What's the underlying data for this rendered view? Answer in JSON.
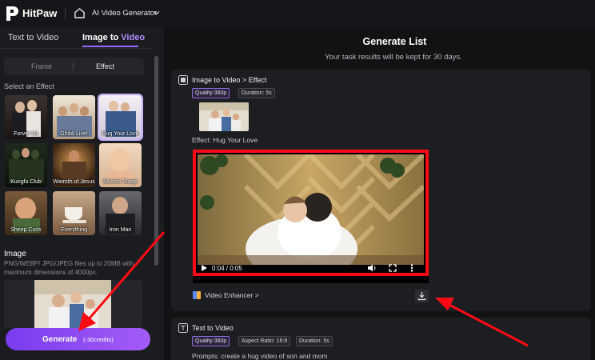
{
  "topbar": {
    "brand": "HitPaw",
    "app_title": "AI Video Generator"
  },
  "sidebar": {
    "tabs": [
      {
        "label": "Text to Video",
        "active": false
      },
      {
        "label_prefix": "Image to ",
        "label_accent": "Video",
        "active": true
      }
    ],
    "segment": {
      "frame": "Frame",
      "effect": "Effect",
      "selected": "Effect"
    },
    "select_label": "Select an Effect",
    "effects": [
      {
        "label": "Forver Us"
      },
      {
        "label": "Ghibli Live!"
      },
      {
        "label": "Hug Your Love",
        "selected": true
      },
      {
        "label": "Kungfu Club"
      },
      {
        "label": "Warmth of Jesus"
      },
      {
        "label": "Muscle Surge"
      },
      {
        "label": "Sheep Curls"
      },
      {
        "label": "Everything"
      },
      {
        "label": "Iron Man"
      }
    ],
    "image_section": {
      "title": "Image",
      "description": "PNG/WEBP/ JPG/JPEG files up to 20MB with maximum dimensions of 4000px."
    },
    "generate": {
      "label": "Generate",
      "credits": "(-30credits)"
    }
  },
  "main": {
    "title": "Generate List",
    "subtitle": "Your task results will be kept for 30 days.",
    "card1": {
      "title": "Image to Video > Effect",
      "quality": "Quality:360p",
      "duration": "Duration: 5s",
      "effect_text": "Effect: Hug Your Love",
      "video": {
        "time": "0:04 / 0:05"
      },
      "enhancer": "Video Enhancer >"
    },
    "card2": {
      "title": "Text to Video",
      "quality": "Quality:360p",
      "aspect": "Aspect Ratio: 16:9",
      "duration": "Duration: 5s",
      "prompt": "Prompts:  create a hug video of son and mom"
    }
  },
  "colors": {
    "accent": "#9d6bff",
    "highlight": "#ff0a14",
    "background": "#111214",
    "panel": "#1b1c20"
  }
}
